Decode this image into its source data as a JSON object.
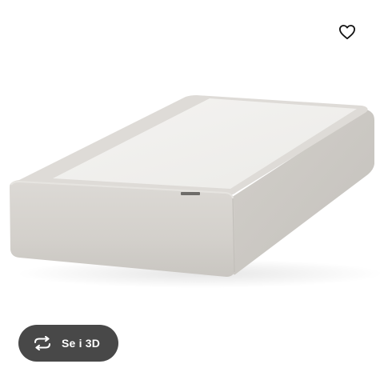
{
  "product": {
    "image_subject": "mattress-base"
  },
  "actions": {
    "favorite_icon": "heart-outline-icon",
    "view_3d_icon": "rotate-arrows-icon",
    "view_3d_label": "Se i 3D"
  },
  "colors": {
    "background": "#ffffff",
    "button_background": "#484848",
    "button_text": "#ffffff",
    "icon": "#111111",
    "fabric": "#d6d3cf",
    "fabric_top_panel": "#f2f1ee"
  }
}
